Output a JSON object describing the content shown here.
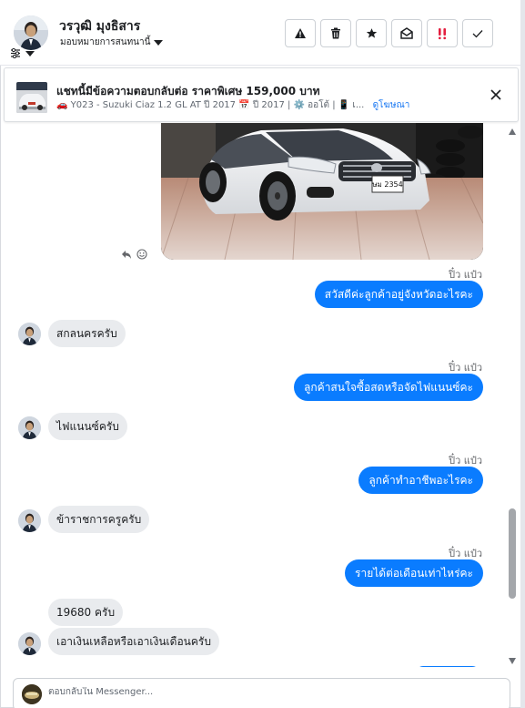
{
  "header": {
    "contact_name": "วรวุฒิ มุงธิสาร",
    "assign_label": "มอบหมายการสนทนานี้",
    "actions": [
      {
        "name": "spam-icon",
        "color": "#1c1e21"
      },
      {
        "name": "trash-icon",
        "color": "#1c1e21"
      },
      {
        "name": "star-icon",
        "color": "#1c1e21"
      },
      {
        "name": "mark-unread-icon",
        "color": "#1c1e21"
      },
      {
        "name": "follow-up-icon",
        "color": "#e41e3f"
      },
      {
        "name": "done-check-icon",
        "color": "#1c1e21"
      }
    ]
  },
  "ad": {
    "title": "แชทนี้มีข้อความตอบกลับต่อ ราคาพิเศษ 159,000 บาท",
    "subtitle": "🚗 Y023 - Suzuki Ciaz 1.2 GL AT ปี 2017 📅 ปี 2017 | ⚙️ ออโต้ | 📱 เ...",
    "link": "ดูโฆษณา"
  },
  "thread": {
    "car_plate": "ษม 2354",
    "messages": [
      {
        "dir": "out",
        "sender": "ปิ๋ว แป๋ว",
        "text": "สวัสดีค่ะลูกค้าอยู่จังหวัดอะไรคะ"
      },
      {
        "dir": "in",
        "text": "สกลนครครับ"
      },
      {
        "dir": "out",
        "sender": "ปิ๋ว แป๋ว",
        "text": "ลูกค้าสนใจซื้อสดหรือจัดไฟแนนซ์คะ"
      },
      {
        "dir": "in",
        "text": "ไฟแนนซ์ครับ"
      },
      {
        "dir": "out",
        "sender": "ปิ๋ว แป๋ว",
        "text": "ลูกค้าทำอาชีพอะไรคะ"
      },
      {
        "dir": "in",
        "text": "ข้าราชการครูครับ"
      },
      {
        "dir": "out",
        "sender": "ปิ๋ว แป๋ว",
        "text": "รายได้ต่อเดือนเท่าไหร่คะ"
      },
      {
        "dir": "in",
        "text": "19680 ครับ"
      },
      {
        "dir": "in",
        "text": "เอาเงินเหลือหรือเอาเงินเดือนครับ"
      }
    ]
  },
  "composer": {
    "placeholder": "ตอบกลับใน Messenger..."
  },
  "colors": {
    "accent": "#0a7cff",
    "incoming_bubble": "#e9ebee",
    "link": "#1877f2"
  }
}
